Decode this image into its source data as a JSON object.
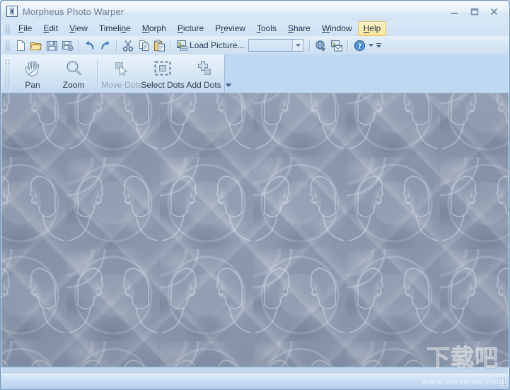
{
  "window": {
    "title": "Morpheus Photo Warper",
    "app_icon": "app-logo-icon",
    "controls": {
      "minimize": "minimize-icon",
      "maximize": "maximize-icon",
      "close": "close-icon"
    }
  },
  "menubar": {
    "grip": "menu-grip",
    "items": [
      {
        "label": "File",
        "pre": "",
        "key": "F",
        "post": "ile",
        "active": false
      },
      {
        "label": "Edit",
        "pre": "",
        "key": "E",
        "post": "dit",
        "active": false
      },
      {
        "label": "View",
        "pre": "",
        "key": "V",
        "post": "iew",
        "active": false
      },
      {
        "label": "Timeline",
        "pre": "Timeli",
        "key": "n",
        "post": "e",
        "active": false
      },
      {
        "label": "Morph",
        "pre": "",
        "key": "M",
        "post": "orph",
        "active": false
      },
      {
        "label": "Picture",
        "pre": "",
        "key": "P",
        "post": "icture",
        "active": false
      },
      {
        "label": "Preview",
        "pre": "P",
        "key": "r",
        "post": "eview",
        "active": false
      },
      {
        "label": "Tools",
        "pre": "",
        "key": "T",
        "post": "ools",
        "active": false
      },
      {
        "label": "Share",
        "pre": "",
        "key": "S",
        "post": "hare",
        "active": false
      },
      {
        "label": "Window",
        "pre": "",
        "key": "W",
        "post": "indow",
        "active": false
      },
      {
        "label": "Help",
        "pre": "",
        "key": "H",
        "post": "elp",
        "active": true
      }
    ]
  },
  "toolbar": {
    "buttons": [
      {
        "name": "new-icon",
        "title": "New"
      },
      {
        "name": "open-icon",
        "title": "Open"
      },
      {
        "name": "save-icon",
        "title": "Save"
      },
      {
        "name": "save-as-icon",
        "title": "Save As"
      },
      {
        "name": "undo-icon",
        "title": "Undo"
      },
      {
        "name": "redo-icon",
        "title": "Redo"
      },
      {
        "name": "cut-icon",
        "title": "Cut"
      },
      {
        "name": "copy-icon",
        "title": "Copy"
      },
      {
        "name": "paste-icon",
        "title": "Paste"
      }
    ],
    "load_picture": {
      "icon": "load-picture-icon",
      "label": "Load Picture..."
    },
    "combo": {
      "value": "",
      "placeholder": "",
      "arrow": "chevron-down-icon"
    },
    "right_buttons": [
      {
        "name": "publish-web-icon",
        "title": "Publish to Web"
      },
      {
        "name": "email-icon",
        "title": "E-mail"
      }
    ],
    "help_button": {
      "icon": "help-question-icon",
      "arrow": "chevron-down-icon"
    },
    "overflow": "toolbar-overflow-icon"
  },
  "toolpanel": {
    "grip": "toolpanel-grip",
    "tools": [
      {
        "id": "pan",
        "label": "Pan",
        "icon": "hand-icon",
        "disabled": false
      },
      {
        "id": "zoom",
        "label": "Zoom",
        "icon": "magnifier-icon",
        "disabled": false
      },
      {
        "id": "move-dots",
        "label": "Move Dots",
        "icon": "move-cursor-icon",
        "disabled": true
      },
      {
        "id": "select-dots",
        "label": "Select Dots",
        "icon": "marquee-icon",
        "disabled": false
      },
      {
        "id": "add-dots",
        "label": "Add Dots",
        "icon": "add-dot-icon",
        "disabled": false
      }
    ],
    "overflow": "toolpanel-overflow-icon"
  },
  "canvas": {
    "description": "Tiled abstract warped image: repeating face-profile silhouettes over interlocking rings in blue-grey",
    "base_color": "#8794ab",
    "highlight_color": "#e8f1fb"
  },
  "statusbar": {
    "text": ""
  },
  "watermark": {
    "cn": "下载吧",
    "url": "www.xiazaiba.com"
  },
  "colors": {
    "window_border": "#6f93bd",
    "title_text": "#6d7e93",
    "menu_bg": "#d4e4f6",
    "menu_highlight": "#fbe79a",
    "toolbar_bg": "#d7e7f6",
    "panel_bg": "#bfd8f1",
    "status_bg": "#c9ddf4",
    "text": "#22384f",
    "disabled_text": "#8ea4ba"
  }
}
